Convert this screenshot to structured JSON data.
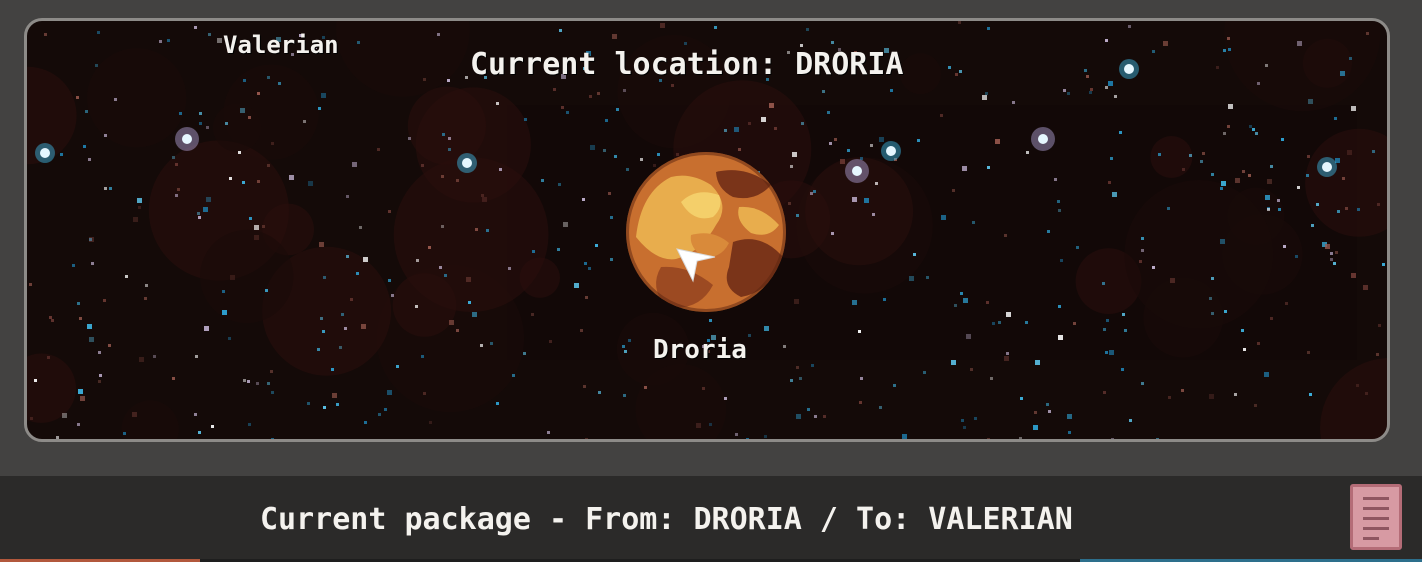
{
  "map": {
    "other_planet_label": "Valerian",
    "current_location_text": "Current location: DRORIA",
    "planet_label": "Droria",
    "planet_colors": [
      "#e8ad4d",
      "#c86f2f",
      "#7a3419",
      "#f4cf6a"
    ]
  },
  "status_bar": {
    "package_text": "Current package - From: DRORIA / To: VALERIAN",
    "document_icon": "document-icon"
  }
}
